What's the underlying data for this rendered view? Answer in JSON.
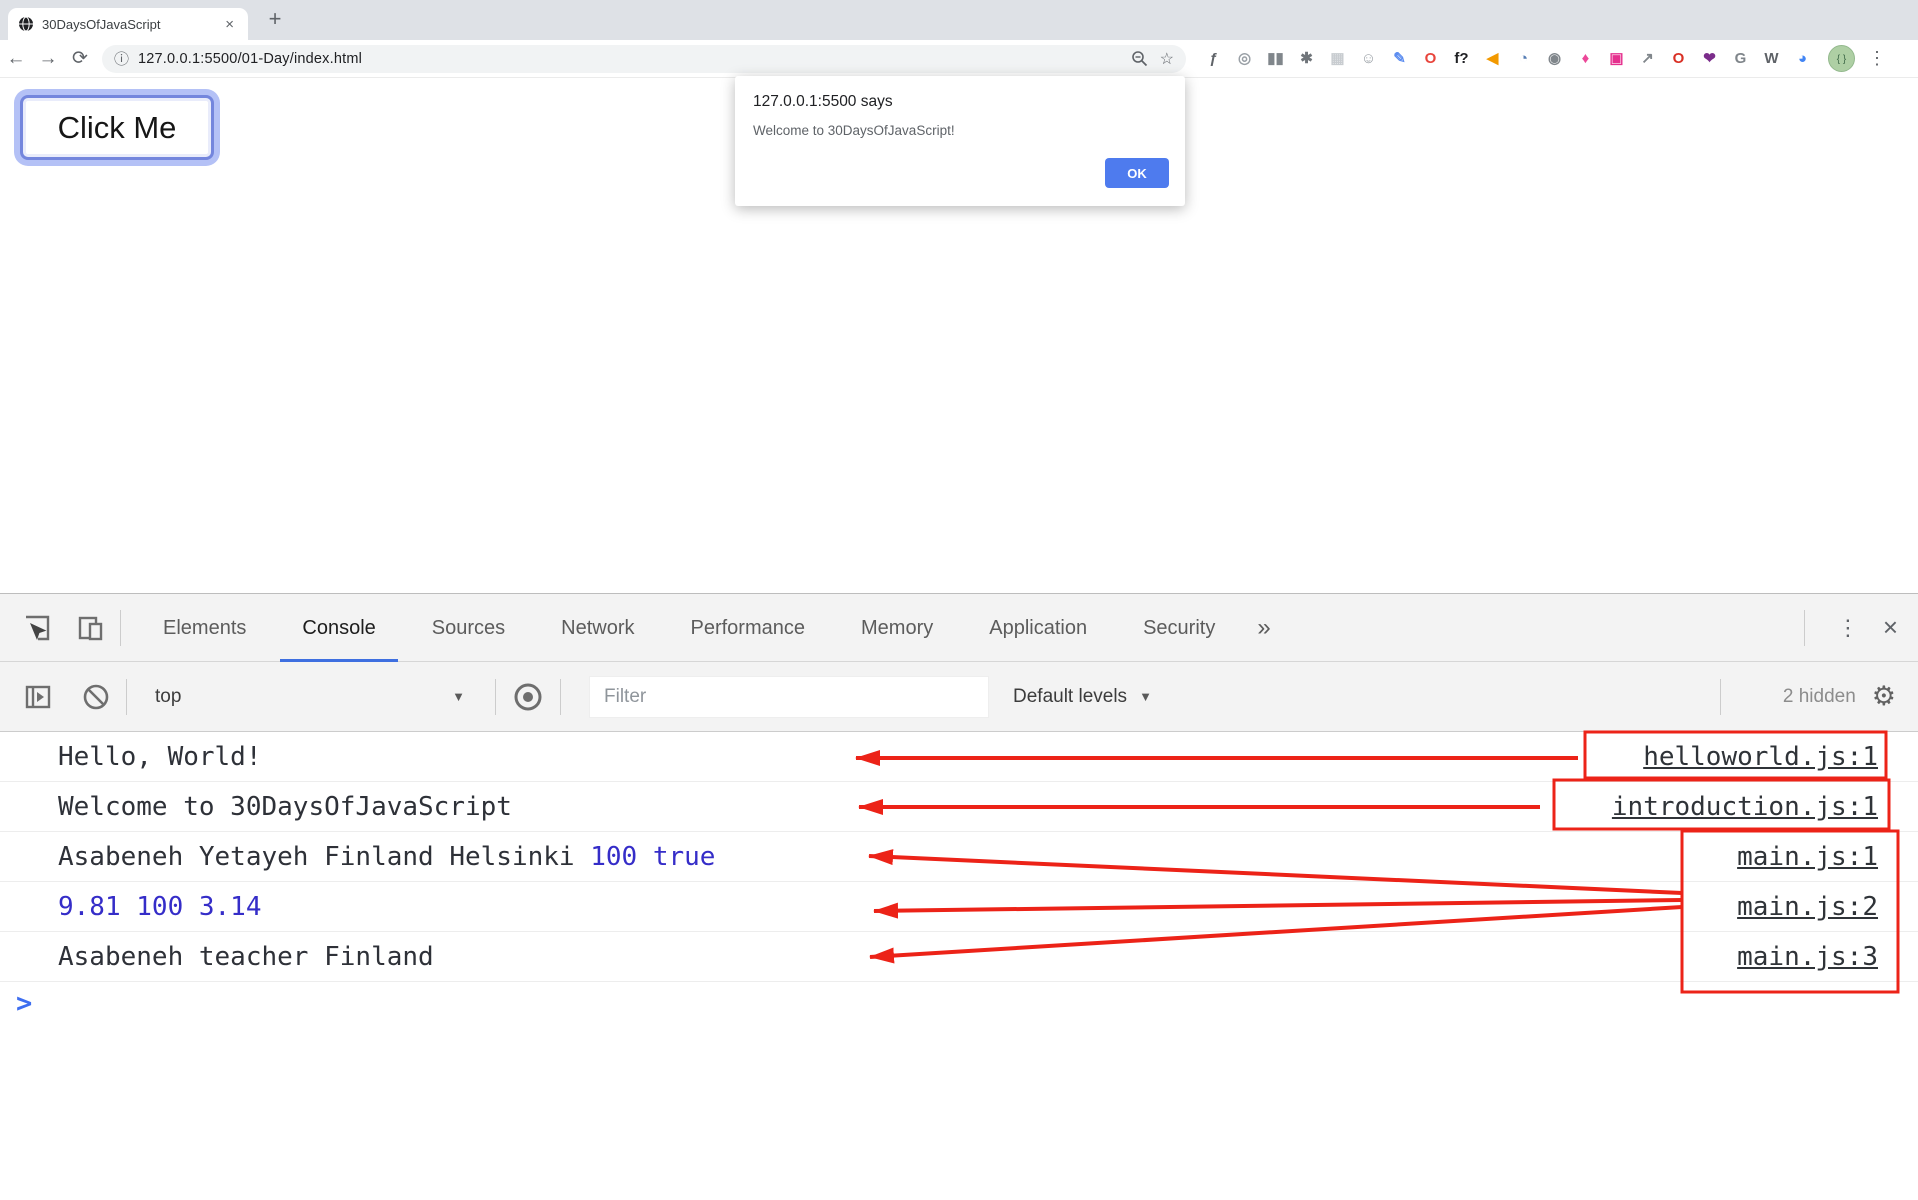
{
  "browser": {
    "tab_title": "30DaysOfJavaScript",
    "tab_close": "×",
    "new_tab": "+",
    "back": "←",
    "forward": "→",
    "reload": "⟳",
    "info": "ⓘ",
    "url": "127.0.0.1:5500/01-Day/index.html",
    "star": "☆",
    "menu": "⋮",
    "avatar_glyph": "{ }",
    "extensions": [
      {
        "name": "fx-icon",
        "glyph": "ƒ",
        "color": "#5f6368"
      },
      {
        "name": "atom-icon",
        "glyph": "◎",
        "color": "#9aa0a6"
      },
      {
        "name": "pause-icon",
        "glyph": "▮▮",
        "color": "#80868b"
      },
      {
        "name": "bug-icon",
        "glyph": "✱",
        "color": "#70757a"
      },
      {
        "name": "grid-icon",
        "glyph": "▦",
        "color": "#c8ccd0"
      },
      {
        "name": "emoji-icon",
        "glyph": "☺",
        "color": "#9aa0a6"
      },
      {
        "name": "eyedropper-icon",
        "glyph": "✎",
        "color": "#5c8df0"
      },
      {
        "name": "opera-icon",
        "glyph": "O",
        "color": "#e8453c"
      },
      {
        "name": "f-question-icon",
        "glyph": "f?",
        "color": "#202124"
      },
      {
        "name": "megaphone-icon",
        "glyph": "◀",
        "color": "#f29900"
      },
      {
        "name": "lens-icon",
        "glyph": "◔",
        "color": "#567db4"
      },
      {
        "name": "camera-icon",
        "glyph": "◉",
        "color": "#80868b"
      },
      {
        "name": "bell-icon",
        "glyph": "♦",
        "color": "#ec4899"
      },
      {
        "name": "pink-box-icon",
        "glyph": "▣",
        "color": "#e5308e"
      },
      {
        "name": "share-icon",
        "glyph": "↗",
        "color": "#80868b"
      },
      {
        "name": "shield-o-icon",
        "glyph": "O",
        "color": "#d93025"
      },
      {
        "name": "heart-search-icon",
        "glyph": "❤",
        "color": "#7b2d8b"
      },
      {
        "name": "g-icon",
        "glyph": "G",
        "color": "#80868b"
      },
      {
        "name": "w-icon",
        "glyph": "W",
        "color": "#5f6368"
      },
      {
        "name": "color-wheel-icon",
        "glyph": "◕",
        "color": "#4285f4"
      }
    ]
  },
  "page": {
    "button_label": "Click Me"
  },
  "dialog": {
    "title": "127.0.0.1:5500 says",
    "message": "Welcome to 30DaysOfJavaScript!",
    "ok_label": "OK",
    "accent": "#4e7bee"
  },
  "devtools": {
    "tabs": [
      "Elements",
      "Console",
      "Sources",
      "Network",
      "Performance",
      "Memory",
      "Application",
      "Security"
    ],
    "active_tab": "Console",
    "more_tabs": "»",
    "menu_dots": "⋮",
    "close": "×",
    "toolbar": {
      "context_label": "top",
      "caret": "▼",
      "filter_placeholder": "Filter",
      "levels_label": "Default levels",
      "hidden_badge": "2 hidden",
      "gear": "⚙"
    },
    "console_rows": {
      "r1": {
        "text": "Hello, World!",
        "source": "helloworld.js:1"
      },
      "r2": {
        "text": "Welcome to 30DaysOfJavaScript",
        "source": "introduction.js:1"
      },
      "r3": {
        "text": "Asabeneh Yetayeh Finland Helsinki ",
        "value": "100 true",
        "source": "main.js:1"
      },
      "r4": {
        "value": "9.81 100 3.14",
        "source": "main.js:2"
      },
      "r5": {
        "text": "Asabeneh teacher Finland",
        "source": "main.js:3"
      }
    },
    "prompt": ">"
  },
  "annotations": {
    "color": "#ec2318"
  }
}
